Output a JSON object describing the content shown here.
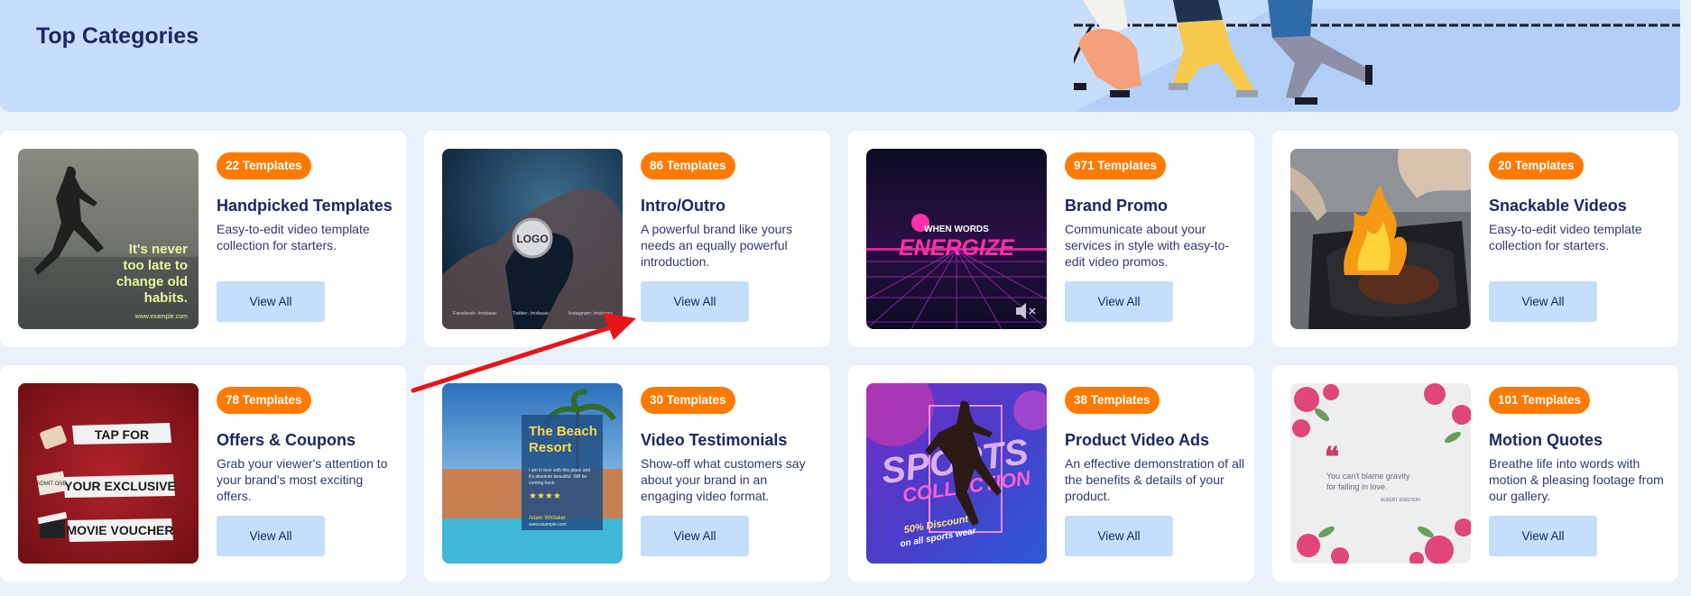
{
  "banner": {
    "title": "Top Categories"
  },
  "view_label": "View All",
  "cards": [
    {
      "badge": "22 Templates",
      "title": "Handpicked Templates",
      "desc": "Easy-to-edit video template collection for starters.",
      "thumb": {
        "lines": [
          "It's never",
          "too late to",
          "change old",
          "habits."
        ],
        "footer": "www.example.com"
      }
    },
    {
      "badge": "86 Templates",
      "title": "Intro/Outro",
      "desc": "A powerful brand like yours needs an equally powerful introduction.",
      "thumb": {
        "logo": "LOGO",
        "footer1": "Facebook: /mxbasic",
        "footer2": "Twitter: /mxbasic",
        "footer3": "Instagram: /mxbasic"
      }
    },
    {
      "badge": "971 Templates",
      "title": "Brand Promo",
      "desc": "Communicate about your services in style with easy-to-edit video promos.",
      "thumb": {
        "top": "WHEN WORDS",
        "main": "ENERGIZE"
      }
    },
    {
      "badge": "20 Templates",
      "title": "Snackable Videos",
      "desc": "Easy-to-edit video template collection for starters.",
      "thumb": {}
    },
    {
      "badge": "78 Templates",
      "title": "Offers & Coupons",
      "desc": "Grab your viewer's attention to your brand's most exciting offers.",
      "thumb": {
        "l1": "TAP FOR",
        "l2": "YOUR EXCLUSIVE",
        "l3": "MOVIE VOUCHER",
        "ticket": "ADMIT ONE"
      }
    },
    {
      "badge": "30 Templates",
      "title": "Video Testimonials",
      "desc": "Show-off what customers say about your brand in an engaging video format.",
      "thumb": {
        "title1": "The Beach",
        "title2": "Resort",
        "body1": "I am in love with this place and",
        "body2": "it's absolute beautiful. Will be",
        "body3": "coming back.",
        "stars": "★★★★",
        "name": "Adam Whitaker",
        "site": "www.example.com"
      }
    },
    {
      "badge": "38 Templates",
      "title": "Product Video Ads",
      "desc": "An effective demonstration of all the benefits & details of your product.",
      "thumb": {
        "word1": "SPORTS",
        "word2": "COLLECTION",
        "disc1": "50% Discount",
        "disc2": "on all sports wear"
      }
    },
    {
      "badge": "101 Templates",
      "title": "Motion Quotes",
      "desc": "Breathe life into words with motion & pleasing footage from our gallery.",
      "thumb": {
        "quote1": "You can't blame gravity",
        "quote2": "for falling in love.",
        "author": "ALBERT EINSTEIN"
      }
    }
  ],
  "colors": {
    "badge": "#ff7a00",
    "button": "#c4defb",
    "title": "#1c2763",
    "banner": "#c6defb",
    "arrow": "#e8141a"
  }
}
